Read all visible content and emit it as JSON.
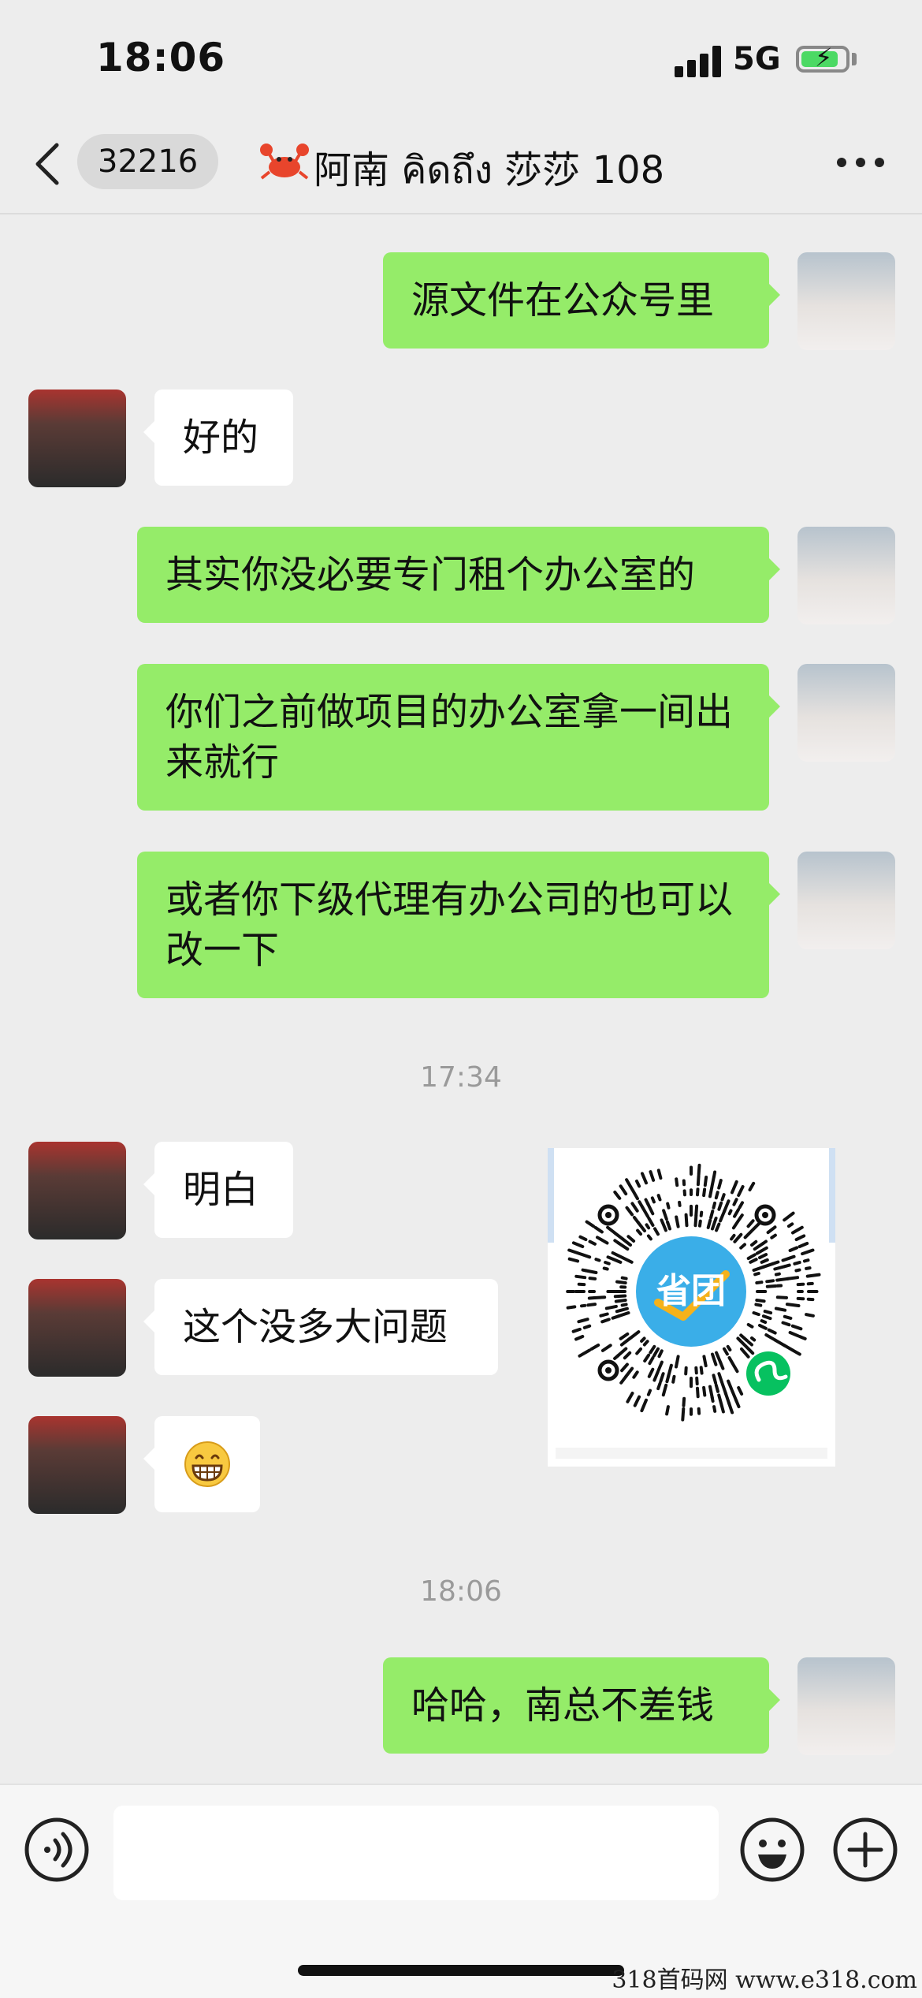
{
  "status_bar": {
    "time": "18:06",
    "network": "5G",
    "battery_state": "charging"
  },
  "header": {
    "unread_count": "32216",
    "title": "阿南 คิดถึง 莎莎 108",
    "title_icon": "crab-emoji-icon",
    "back_icon": "chevron-left-icon",
    "more_icon": "more-dots-icon"
  },
  "messages": [
    {
      "sender": "me",
      "text": "源文件在公众号里"
    },
    {
      "sender": "contact",
      "text": "好的"
    },
    {
      "sender": "me",
      "text": "其实你没必要专门租个办公室的"
    },
    {
      "sender": "me",
      "text": "你们之前做项目的办公室拿一间出来就行"
    },
    {
      "sender": "me",
      "text": "或者你下级代理有办公司的也可以改一下"
    },
    {
      "type": "time",
      "text": "17:34"
    },
    {
      "sender": "contact",
      "text": "明白"
    },
    {
      "sender": "contact",
      "text": "这个没多大问题"
    },
    {
      "sender": "contact",
      "emoji": "grinning-face-icon"
    },
    {
      "type": "image",
      "content": "mini-program-qr-code",
      "center_text": "省团"
    },
    {
      "type": "time",
      "text": "18:06"
    },
    {
      "sender": "me",
      "text": "哈哈，南总不差钱"
    }
  ],
  "input_bar": {
    "voice_icon": "voice-icon",
    "emoji_icon": "emoji-icon",
    "plus_icon": "plus-icon",
    "input_value": ""
  },
  "watermark": "318首码网 www.e318.com",
  "colors": {
    "background": "#ededed",
    "outgoing_bubble": "#95ec69",
    "incoming_bubble": "#ffffff",
    "timestamp": "#9a9a9a",
    "qr_badge": "#3aaee8",
    "mini_program_icon": "#07c160"
  }
}
